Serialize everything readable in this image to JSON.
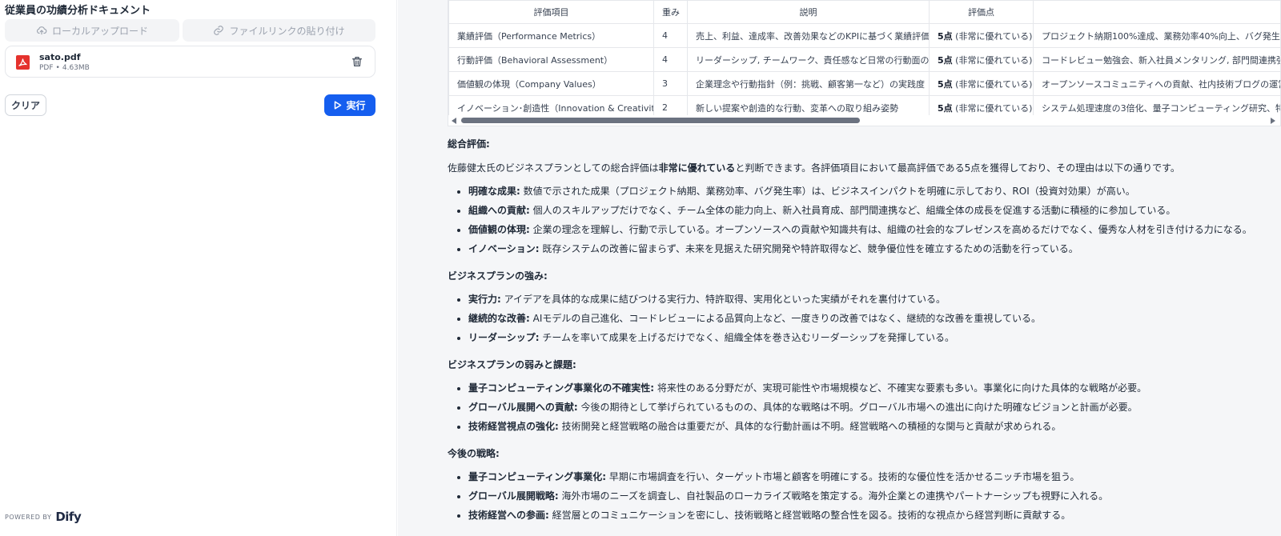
{
  "left": {
    "title": "従業員の功績分析ドキュメント",
    "upload_local_label": "ローカルアップロード",
    "upload_link_label": "ファイルリンクの貼り付け",
    "file": {
      "name": "sato.pdf",
      "type": "PDF",
      "size": "4.63MB"
    },
    "clear_label": "クリア",
    "run_label": "実行",
    "powered_by": "POWERED BY",
    "brand": "Dify"
  },
  "table": {
    "headers": [
      "評価項目",
      "重み",
      "説明",
      "評価点",
      ""
    ],
    "rows": [
      {
        "item": "業績評価（Performance Metrics）",
        "weight": "4",
        "desc": "売上、利益、達成率、改善効果などのKPIに基づく業績評価",
        "score_bold": "5点",
        "score_rest": " (非常に優れている)",
        "evidence": "プロジェクト納期100%達成、業務効率40%向上、バグ発生"
      },
      {
        "item": "行動評価（Behavioral Assessment）",
        "weight": "4",
        "desc": "リーダーシップ, チームワーク、責任感など日常の行動面の評価",
        "score_bold": "5点",
        "score_rest": " (非常に優れている)",
        "evidence": "コードレビュー勉強会、新入社員メンタリング, 部門間連携強"
      },
      {
        "item": "価値観の体現（Company Values）",
        "weight": "3",
        "desc": "企業理念や行動指針（例：挑戦、顧客第一など）の実践度",
        "score_bold": "5点",
        "score_rest": " (非常に優れている)",
        "evidence": "オープンソースコミュニティへの貢献、社内技術ブログの運営に"
      },
      {
        "item": "イノベーション･創造性（Innovation & Creativity）",
        "weight": "2",
        "desc": "新しい提案や創造的な行動、変革への取り組み姿勢",
        "score_bold": "5点",
        "score_rest": " (非常に優れている)",
        "evidence": "システム処理速度の3倍化、量子コンピューティング研究、特"
      }
    ]
  },
  "summary": {
    "heading": "総合評価:",
    "intro_a": "佐藤健太氏のビジネスプランとしての総合評価は",
    "intro_bold": "非常に優れている",
    "intro_b": "と判断できます。各評価項目において最高評価である5点を獲得しており、その理由は以下の通りです。",
    "items": [
      {
        "label": "明確な成果:",
        "text": " 数値で示された成果（プロジェクト納期、業務効率、バグ発生率）は、ビジネスインパクトを明確に示しており、ROI（投資対効果）が高い。"
      },
      {
        "label": "組織への貢献:",
        "text": " 個人のスキルアップだけでなく、チーム全体の能力向上、新入社員育成、部門間連携など、組織全体の成長を促進する活動に積極的に参加している。"
      },
      {
        "label": "価値観の体現:",
        "text": " 企業の理念を理解し、行動で示している。オープンソースへの貢献や知識共有は、組織の社会的なプレゼンスを高めるだけでなく、優秀な人材を引き付ける力になる。"
      },
      {
        "label": "イノベーション:",
        "text": " 既存システムの改善に留まらず、未来を見据えた研究開発や特許取得など、競争優位性を確立するための活動を行っている。"
      }
    ]
  },
  "strengths": {
    "heading": "ビジネスプランの強み:",
    "items": [
      {
        "label": "実行力:",
        "text": " アイデアを具体的な成果に結びつける実行力、特許取得、実用化といった実績がそれを裏付けている。"
      },
      {
        "label": "継続的な改善:",
        "text": " AIモデルの自己進化、コードレビューによる品質向上など、一度きりの改善ではなく、継続的な改善を重視している。"
      },
      {
        "label": "リーダーシップ:",
        "text": " チームを率いて成果を上げるだけでなく、組織全体を巻き込むリーダーシップを発揮している。"
      }
    ]
  },
  "weaknesses": {
    "heading": "ビジネスプランの弱みと課題:",
    "items": [
      {
        "label": "量子コンピューティング事業化の不確実性:",
        "text": " 将来性のある分野だが、実現可能性や市場規模など、不確実な要素も多い。事業化に向けた具体的な戦略が必要。"
      },
      {
        "label": "グローバル展開への貢献:",
        "text": " 今後の期待として挙げられているものの、具体的な戦略は不明。グローバル市場への進出に向けた明確なビジョンと計画が必要。"
      },
      {
        "label": "技術経営視点の強化:",
        "text": " 技術開発と経営戦略の融合は重要だが、具体的な行動計画は不明。経営戦略への積極的な関与と貢献が求められる。"
      }
    ]
  },
  "strategy": {
    "heading": "今後の戦略:",
    "items": [
      {
        "label": "量子コンピューティング事業化:",
        "text": " 早期に市場調査を行い、ターゲット市場と顧客を明確にする。技術的な優位性を活かせるニッチ市場を狙う。"
      },
      {
        "label": "グローバル展開戦略:",
        "text": " 海外市場のニーズを調査し、自社製品のローカライズ戦略を策定する。海外企業との連携やパートナーシップも視野に入れる。"
      },
      {
        "label": "技術経営への参画:",
        "text": " 経営層とのコミュニケーションを密にし、技術戦略と経営戦略の整合性を図る。技術的な視点から経営判断に貢献する。"
      }
    ]
  },
  "colors": {
    "primary": "#155eef",
    "pdf_red": "#e5322d"
  },
  "icons": {
    "upload": "cloud-upload-icon",
    "link": "link-icon",
    "file": "pdf-file-icon",
    "delete": "trash-icon",
    "run": "play-icon"
  }
}
